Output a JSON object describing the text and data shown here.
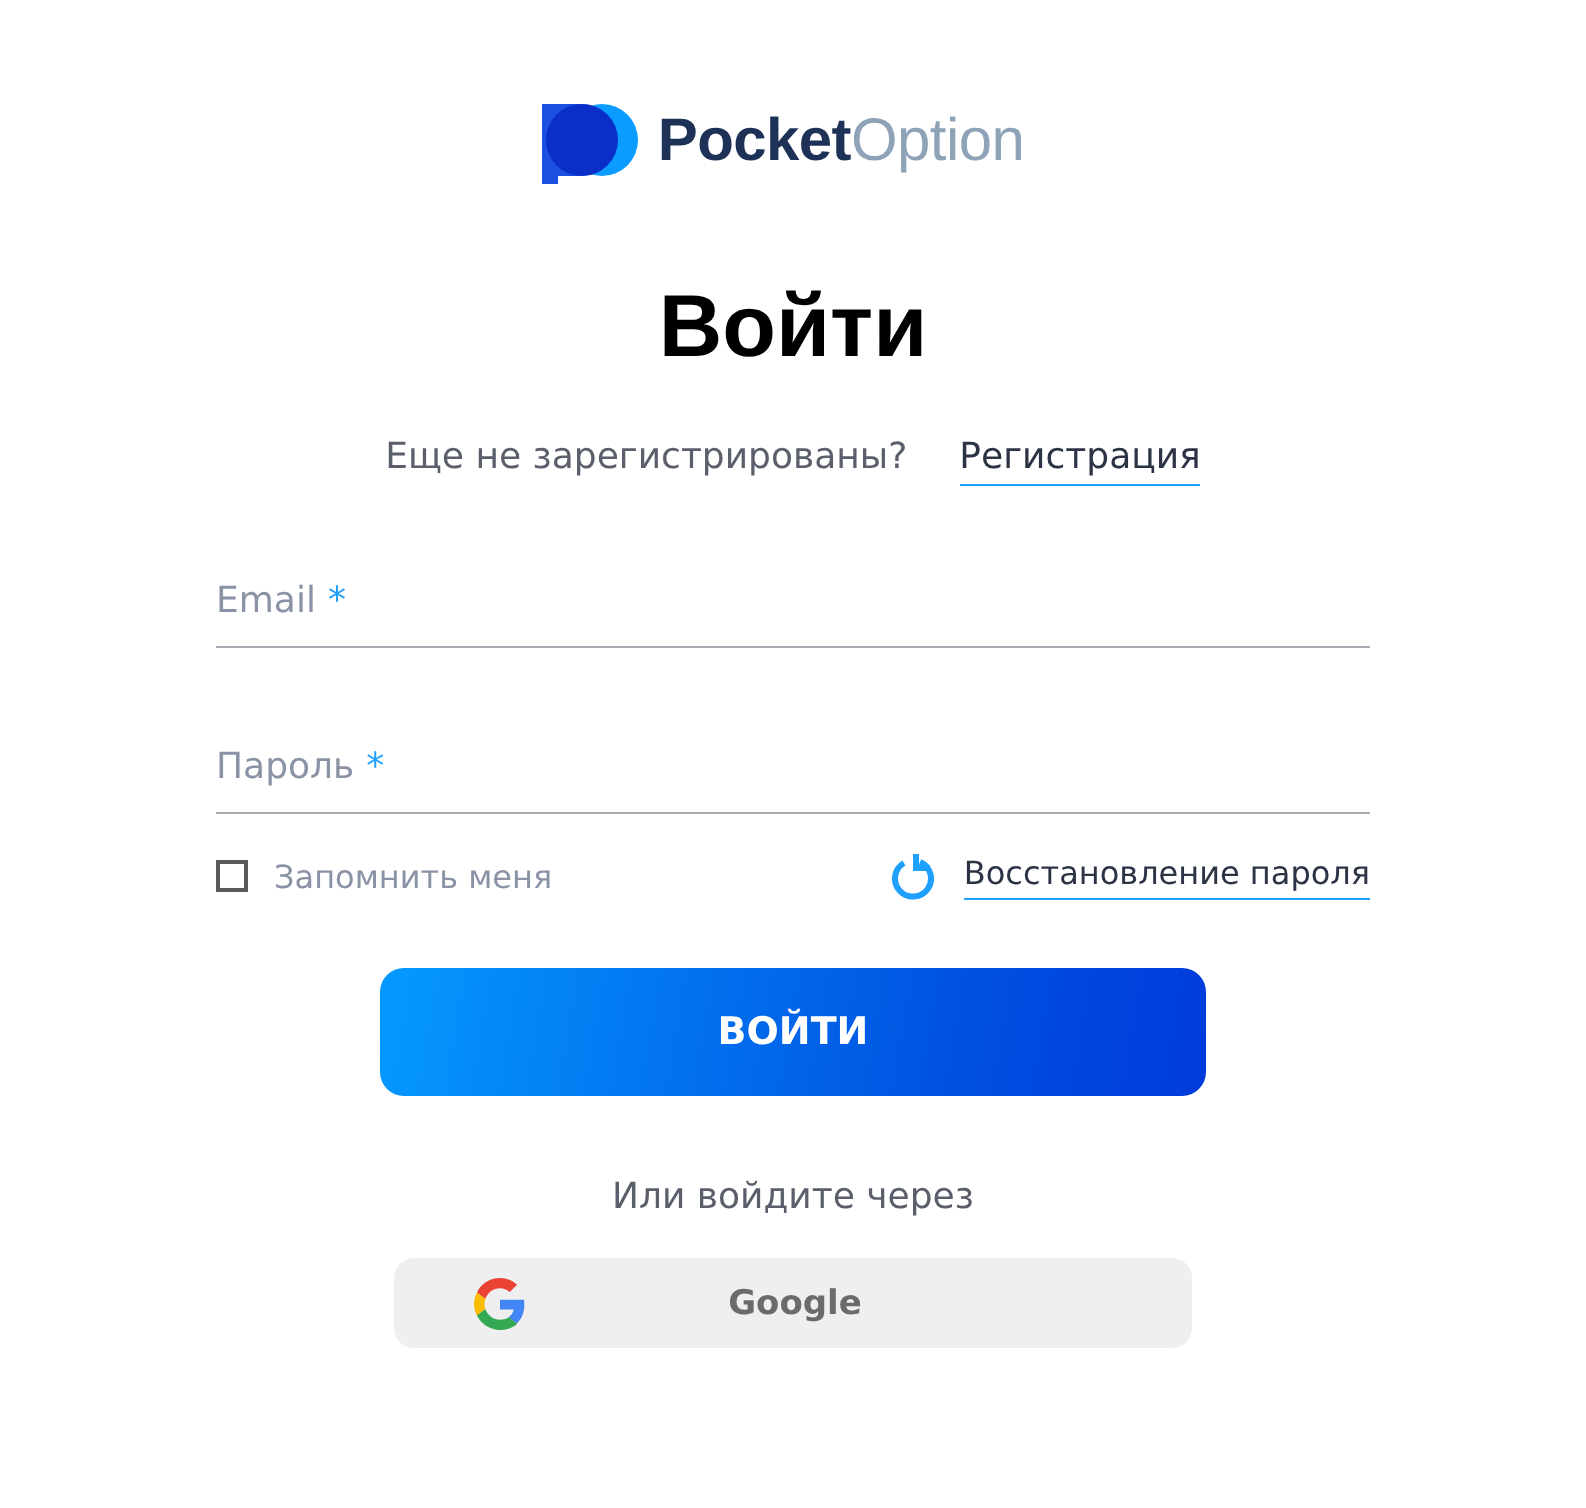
{
  "logo": {
    "part_1": "Pocket",
    "part_2": "Option"
  },
  "title": "Войти",
  "signup_prompt": {
    "text": "Еще не зарегистрированы?",
    "link": "Регистрация"
  },
  "fields": [
    {
      "placeholder": "Email",
      "required_mark": "*"
    },
    {
      "placeholder": "Пароль",
      "required_mark": "*"
    }
  ],
  "remember": {
    "label": "Запомнить меня",
    "checked": false
  },
  "recover_link": "Восстановление пароля",
  "submit": "ВОЙТИ",
  "alt_prompt": "Или войдите через",
  "social": [
    {
      "kind": "google",
      "label": "Google"
    }
  ]
}
